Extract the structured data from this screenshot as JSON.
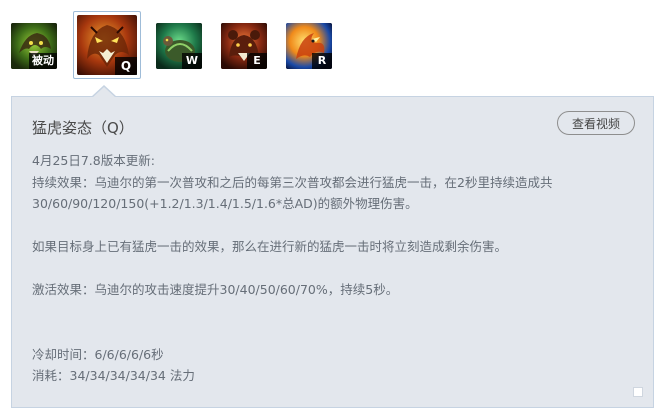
{
  "skills": [
    {
      "key": "被动",
      "icon": "passive-bear-icon",
      "selected": false
    },
    {
      "key": "Q",
      "icon": "tiger-stance-icon",
      "selected": true
    },
    {
      "key": "W",
      "icon": "turtle-stance-icon",
      "selected": false
    },
    {
      "key": "E",
      "icon": "bear-stance-icon",
      "selected": false
    },
    {
      "key": "R",
      "icon": "phoenix-stance-icon",
      "selected": false
    }
  ],
  "detail": {
    "title": "猛虎姿态（Q）",
    "video_button": "查看视频",
    "lines": {
      "update": "4月25日7.8版本更新:",
      "persist_1": "持续效果：乌迪尔的第一次普攻和之后的每第三次普攻都会进行猛虎一击，在2秒里持续造成共",
      "persist_2": "30/60/90/120/150(+1.2/1.3/1.4/1.5/1.6*总AD)的额外物理伤害。",
      "refresh": "如果目标身上已有猛虎一击的效果，那么在进行新的猛虎一击时将立刻造成剩余伤害。",
      "activate": "激活效果：乌迪尔的攻击速度提升30/40/50/60/70%，持续5秒。",
      "cooldown": "冷却时间：6/6/6/6/6秒",
      "cost": "消耗：34/34/34/34/34 法力"
    }
  },
  "colors": {
    "panel_bg": "#e3e7ed",
    "panel_border": "#c6d3e2",
    "text": "#666e78",
    "title": "#4a4a4a"
  }
}
